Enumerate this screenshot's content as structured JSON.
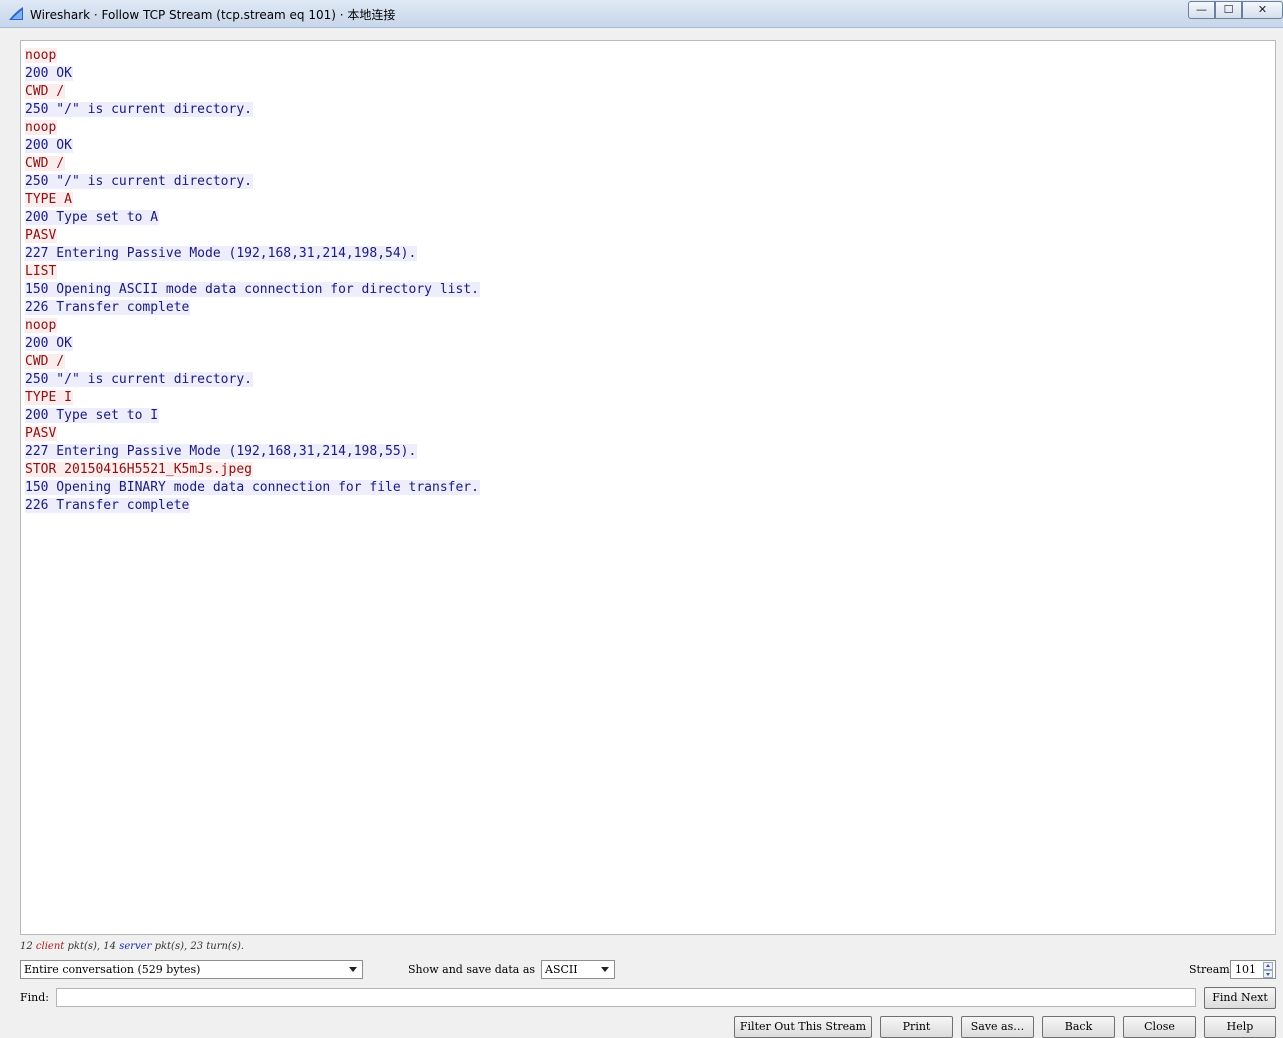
{
  "window": {
    "title": "Wireshark · Follow TCP Stream (tcp.stream eq 101) · 本地连接",
    "controls": {
      "minimize": "—",
      "maximize": "☐",
      "close": "✕"
    }
  },
  "stream_lines": [
    {
      "dir": "client",
      "text": "noop"
    },
    {
      "dir": "server",
      "text": "200 OK"
    },
    {
      "dir": "client",
      "text": "CWD /"
    },
    {
      "dir": "server",
      "text": "250 \"/\" is current directory."
    },
    {
      "dir": "client",
      "text": "noop"
    },
    {
      "dir": "server",
      "text": "200 OK"
    },
    {
      "dir": "client",
      "text": "CWD /"
    },
    {
      "dir": "server",
      "text": "250 \"/\" is current directory."
    },
    {
      "dir": "client",
      "text": "TYPE A"
    },
    {
      "dir": "server",
      "text": "200 Type set to A"
    },
    {
      "dir": "client",
      "text": "PASV"
    },
    {
      "dir": "server",
      "text": "227 Entering Passive Mode (192,168,31,214,198,54)."
    },
    {
      "dir": "client",
      "text": "LIST"
    },
    {
      "dir": "server",
      "text": "150 Opening ASCII mode data connection for directory list."
    },
    {
      "dir": "server",
      "text": "226 Transfer complete"
    },
    {
      "dir": "client",
      "text": "noop"
    },
    {
      "dir": "server",
      "text": "200 OK"
    },
    {
      "dir": "client",
      "text": "CWD /"
    },
    {
      "dir": "server",
      "text": "250 \"/\" is current directory."
    },
    {
      "dir": "client",
      "text": "TYPE I"
    },
    {
      "dir": "server",
      "text": "200 Type set to I"
    },
    {
      "dir": "client",
      "text": "PASV"
    },
    {
      "dir": "server",
      "text": "227 Entering Passive Mode (192,168,31,214,198,55)."
    },
    {
      "dir": "client",
      "text": "STOR 20150416H5521_K5mJs.jpeg"
    },
    {
      "dir": "server",
      "text": "150 Opening BINARY mode data connection for file transfer."
    },
    {
      "dir": "server",
      "text": "226 Transfer complete"
    }
  ],
  "stats": {
    "client_count": "12",
    "client_word": "client",
    "client_suffix": "pkt(s),",
    "server_count": "14",
    "server_word": "server",
    "server_suffix": "pkt(s),",
    "turns": "23 turn(s)."
  },
  "controls": {
    "conversation_select": "Entire conversation (529 bytes)",
    "show_save_label": "Show and save data as",
    "format_select": "ASCII",
    "stream_label": "Stream",
    "stream_value": "101",
    "find_label": "Find:",
    "find_value": ""
  },
  "buttons": {
    "find_next": "Find Next",
    "filter_out": "Filter Out This Stream",
    "print": "Print",
    "save_as": "Save as…",
    "back": "Back",
    "close": "Close",
    "help": "Help"
  },
  "colors": {
    "client_fg": "#8b1111",
    "client_bg": "#fbeded",
    "server_fg": "#1b1b7c",
    "server_bg": "#ededfb"
  }
}
